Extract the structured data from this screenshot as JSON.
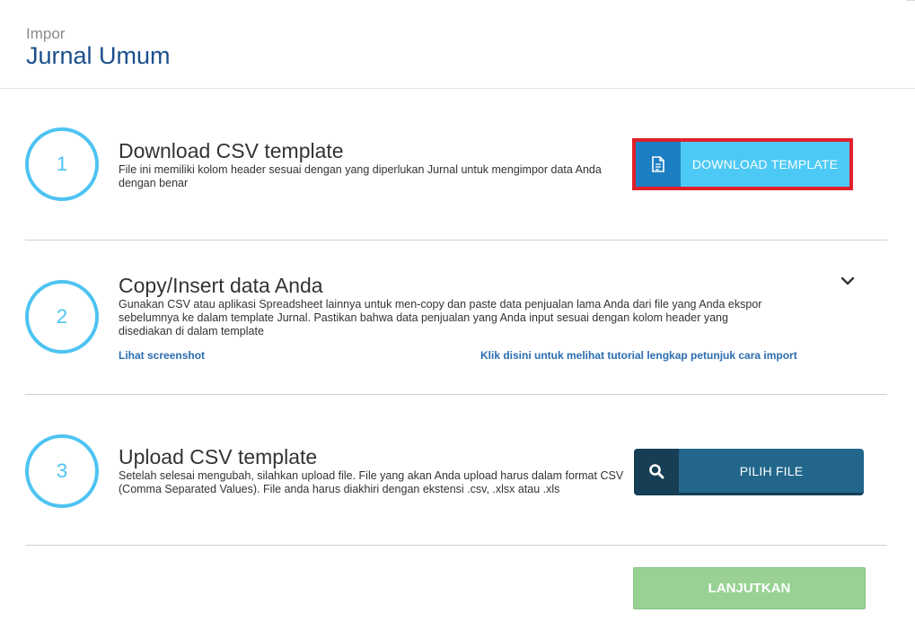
{
  "header": {
    "subtitle": "Impor",
    "title": "Jurnal Umum"
  },
  "steps": [
    {
      "number": "1",
      "title": "Download CSV template",
      "description": "File ini memiliki kolom header sesuai dengan yang diperlukan Jurnal untuk mengimpor data Anda dengan benar",
      "button_label": "DOWNLOAD TEMPLATE",
      "button_icon": "document-icon"
    },
    {
      "number": "2",
      "title": "Copy/Insert data Anda",
      "description": "Gunakan CSV atau aplikasi Spreadsheet lainnya untuk men-copy dan paste data penjualan lama Anda dari file yang Anda ekspor sebelumnya ke dalam template Jurnal. Pastikan bahwa data penjualan yang Anda input sesuai dengan kolom header yang disediakan di dalam template",
      "link_screenshot": "Lihat screenshot",
      "link_tutorial": "Klik disini untuk melihat tutorial lengkap petunjuk cara import",
      "toggle_icon": "chevron-down-icon"
    },
    {
      "number": "3",
      "title": "Upload CSV template",
      "description": "Setelah selesai mengubah, silahkan upload file. File yang akan Anda upload harus dalam format CSV (Comma Separated Values). File anda harus diakhiri dengan ekstensi .csv, .xlsx atau .xls",
      "button_label": "PILIH FILE",
      "button_icon": "search-icon"
    }
  ],
  "footer": {
    "next_label": "LANJUTKAN"
  },
  "colors": {
    "accent": "#4dc3f2",
    "title_blue": "#1b4f8c",
    "download_button": "#4dc9f5",
    "download_icon_bg": "#1c7ec2",
    "highlight": "#e0202a",
    "file_button": "#22678b",
    "file_icon_bg": "#163e55",
    "next_button": "#98d193",
    "link": "#2a6db0"
  }
}
